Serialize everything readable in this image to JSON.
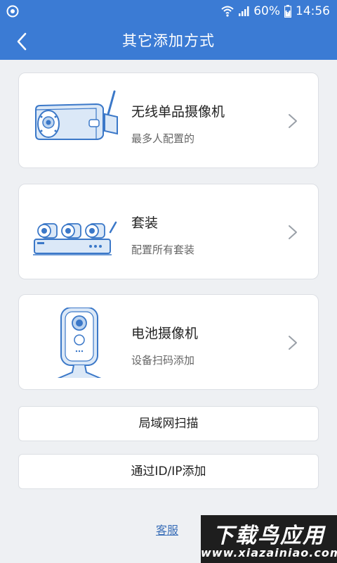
{
  "status_bar": {
    "battery": "60%",
    "time": "14:56",
    "icons": [
      "app-notification-icon",
      "wifi-icon",
      "signal-icon",
      "battery-charging-icon"
    ]
  },
  "app_bar": {
    "title": "其它添加方式",
    "back_icon": "back-arrow-icon"
  },
  "options": [
    {
      "name": "无线单品摄像机",
      "desc": "最多人配置的",
      "icon": "wireless-camera-illustration"
    },
    {
      "name": "套装",
      "desc": "配置所有套装",
      "icon": "camera-kit-illustration"
    },
    {
      "name": "电池摄像机",
      "desc": "设备扫码添加",
      "icon": "battery-camera-illustration"
    }
  ],
  "buttons": {
    "lan_scan": "局域网扫描",
    "add_by_id": "通过ID/IP添加"
  },
  "footer": {
    "service_link": "客服"
  },
  "watermark": {
    "main": "下载鸟应用",
    "sub": "www.xiazainiao.com"
  },
  "colors": {
    "primary": "#3b7bd4",
    "background": "#eef0f3",
    "illustration_stroke": "#3b78c8",
    "illustration_fill": "#dbe8f7"
  }
}
